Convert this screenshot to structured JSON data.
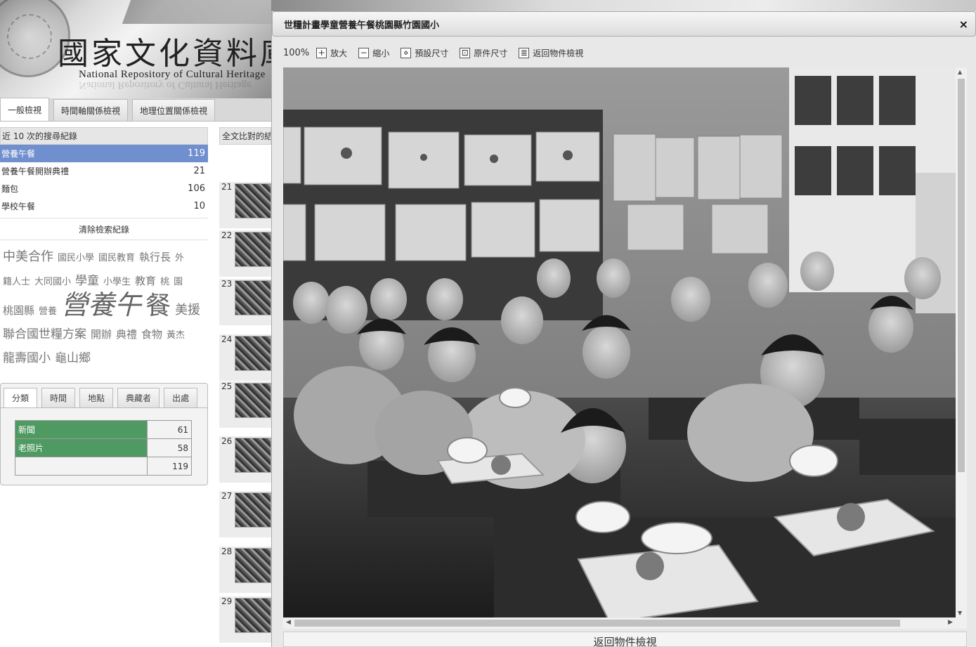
{
  "site": {
    "name_zh": "國家文化資料庫",
    "name_en": "National Repository of Cultural Heritage"
  },
  "main_tabs": [
    "一般檢視",
    "時間軸關係檢視",
    "地理位置關係檢視"
  ],
  "history": {
    "header": "近 10 次的搜尋紀錄",
    "items": [
      {
        "label": "營養午餐",
        "count": "119"
      },
      {
        "label": "營養午餐開辦典禮",
        "count": "21"
      },
      {
        "label": "麵包",
        "count": "106"
      },
      {
        "label": "學校午餐",
        "count": "10"
      }
    ],
    "clear_label": "清除檢索紀錄"
  },
  "tag_cloud": [
    {
      "text": "中美合作",
      "size": "t4"
    },
    {
      "text": "國民小學",
      "size": "t1"
    },
    {
      "text": "國民教育",
      "size": "t1"
    },
    {
      "text": "執行長",
      "size": "t2"
    },
    {
      "text": "外",
      "size": "t1"
    },
    {
      "text": "籍人士",
      "size": "t1"
    },
    {
      "text": "大同國小",
      "size": "t1"
    },
    {
      "text": "學童",
      "size": "t3"
    },
    {
      "text": "小學生",
      "size": "t1"
    },
    {
      "text": "教育",
      "size": "t2"
    },
    {
      "text": "桃",
      "size": "t1"
    },
    {
      "text": "園",
      "size": "t1"
    },
    {
      "text": "桃園縣",
      "size": "t2"
    },
    {
      "text": "營養",
      "size": "t1"
    },
    {
      "text": "營養午",
      "size": "t5"
    },
    {
      "text": "餐",
      "size": "t6"
    },
    {
      "text": "美援",
      "size": "t4"
    },
    {
      "text": "聯合國世糧方案",
      "size": "t3"
    },
    {
      "text": "開辦",
      "size": "t2"
    },
    {
      "text": "典禮",
      "size": "t2"
    },
    {
      "text": "食物",
      "size": "t2"
    },
    {
      "text": "黃杰",
      "size": "t1"
    },
    {
      "text": "龍壽國小",
      "size": "t3"
    },
    {
      "text": "龜山鄉",
      "size": "t3"
    }
  ],
  "facets": {
    "tabs": [
      "分類",
      "時間",
      "地點",
      "典藏者",
      "出處"
    ],
    "rows": [
      {
        "label": "新聞",
        "count": "61",
        "fraction": 0.513
      },
      {
        "label": "老照片",
        "count": "58",
        "fraction": 0.487
      }
    ],
    "total": "119"
  },
  "results": {
    "header": "全文比對的結果",
    "numbers": [
      "21",
      "22",
      "23",
      "24",
      "25",
      "26",
      "27",
      "28",
      "29"
    ]
  },
  "viewer": {
    "title": "世糧計畫學童營養午餐桃園縣竹園國小",
    "close_glyph": "×",
    "zoom_level": "100%",
    "tools": [
      {
        "label": "放大",
        "icon": "zoom-in-icon",
        "glyph": "+"
      },
      {
        "label": "縮小",
        "icon": "zoom-out-icon",
        "glyph": "−"
      },
      {
        "label": "預設尺寸",
        "icon": "default-size-icon",
        "glyph": "⋄"
      },
      {
        "label": "原件尺寸",
        "icon": "original-size-icon",
        "glyph": "⊡"
      },
      {
        "label": "返回物件檢視",
        "icon": "back-document-icon",
        "glyph": "≣"
      }
    ],
    "back_label": "返回物件檢視"
  },
  "colors": {
    "selected_history": "#6f8fce",
    "facet_bar": "#4f9a62"
  }
}
